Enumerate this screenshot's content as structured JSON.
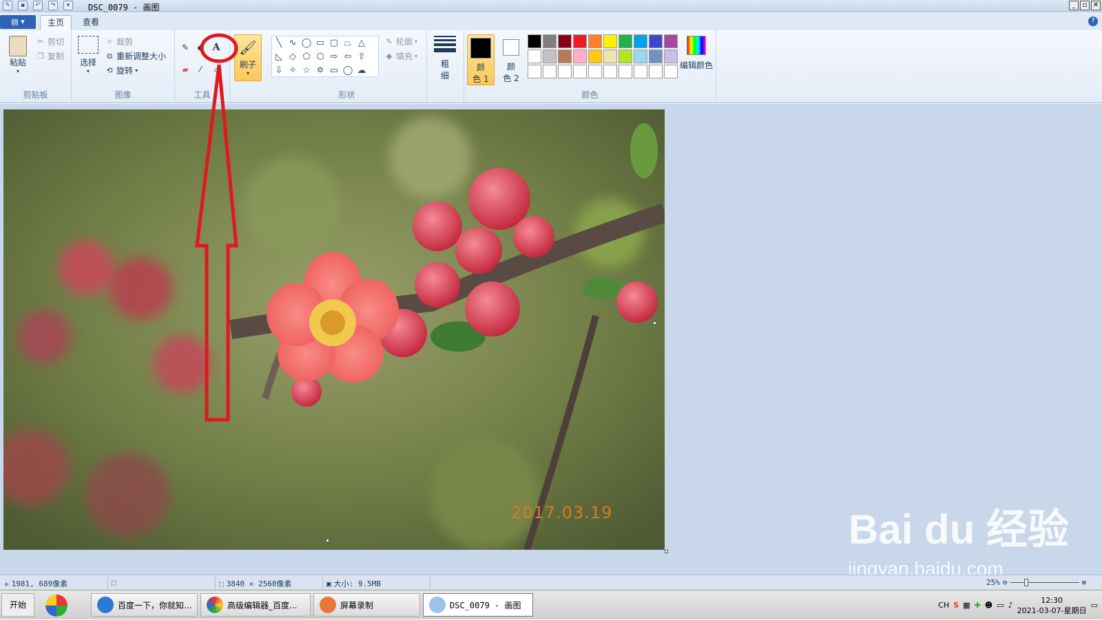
{
  "titlebar": {
    "title": "DSC_0079 - 画图"
  },
  "tabs": [
    {
      "label": "主页"
    },
    {
      "label": "查看"
    }
  ],
  "ribbon": {
    "clipboard": {
      "label": "剪贴板",
      "paste": "粘贴",
      "cut": "剪切",
      "copy": "复制"
    },
    "image": {
      "label": "图像",
      "select": "选择",
      "crop": "裁剪",
      "resize": "重新调整大小",
      "rotate": "旋转"
    },
    "tools": {
      "label": "工具",
      "brushes": "刷子"
    },
    "shapes": {
      "label": "形状",
      "outline": "轮廓",
      "fill": "填充"
    },
    "size": {
      "label_line1": "粗",
      "label_line2": "细"
    },
    "colors": {
      "label": "颜色",
      "color1_line1": "颜",
      "color1_line2": "色 1",
      "color2_line1": "颜",
      "color2_line2": "色 2",
      "edit": "编辑颜色",
      "palette_row1": [
        "#000000",
        "#7f7f7f",
        "#880015",
        "#ed1c24",
        "#ff7f27",
        "#fff200",
        "#22b14c",
        "#00a2e8",
        "#3f48cc",
        "#a349a4"
      ],
      "palette_row2": [
        "#ffffff",
        "#c3c3c3",
        "#b97a57",
        "#ffaec9",
        "#ffc90e",
        "#efe4b0",
        "#b5e61d",
        "#99d9ea",
        "#7092be",
        "#c8bfe7"
      ],
      "palette_row3": [
        "#ffffff",
        "#ffffff",
        "#ffffff",
        "#ffffff",
        "#ffffff",
        "#ffffff",
        "#ffffff",
        "#ffffff",
        "#ffffff",
        "#ffffff"
      ]
    }
  },
  "canvas": {
    "date_stamp": "2017.03.19"
  },
  "watermark": {
    "brand": "Bai du 经验",
    "url": "jingyan.baidu.com"
  },
  "statusbar": {
    "cursor_pos": "1981, 689像素",
    "dimensions": "3840 × 2560像素",
    "size": "大小: 9.5MB",
    "zoom": "25%"
  },
  "taskbar": {
    "start": "开始",
    "items": [
      {
        "label": "百度一下，你就知..."
      },
      {
        "label": "高级编辑器_百度..."
      },
      {
        "label": "屏幕录制"
      },
      {
        "label": "DSC_0079 - 画图"
      }
    ],
    "lang": "CH",
    "time": "12:30",
    "date": "2021-03-07-星期日"
  }
}
